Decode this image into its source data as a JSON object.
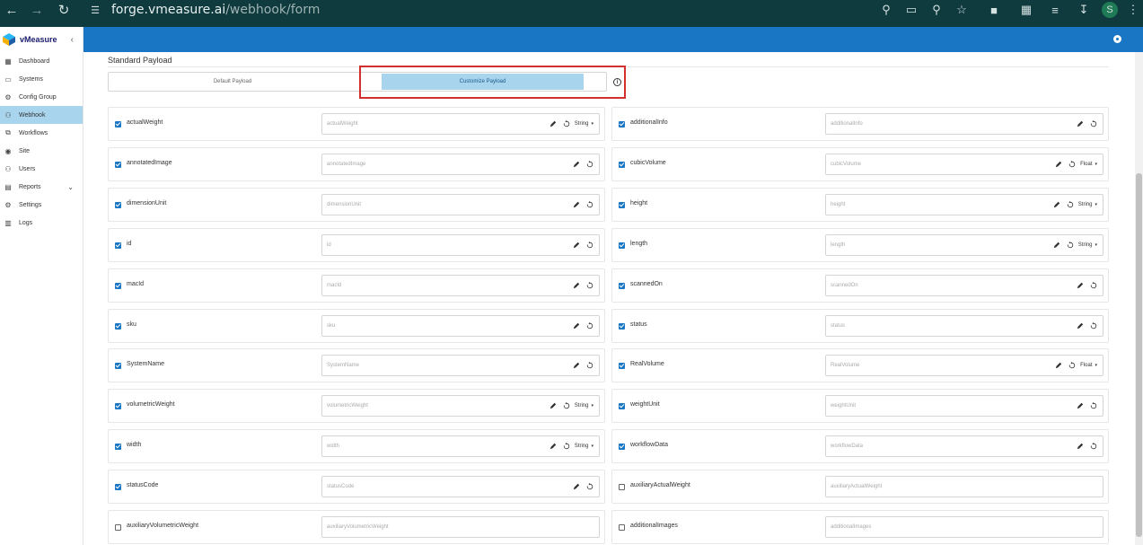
{
  "browser": {
    "url_host": "forge.vmeasure.ai",
    "url_path": "/webhook/form",
    "profile_initial": "S"
  },
  "brand": {
    "name": "vMeasure"
  },
  "sidebar": {
    "items": [
      {
        "label": "Dashboard",
        "icon": "dashboard-icon"
      },
      {
        "label": "Systems",
        "icon": "monitor-icon"
      },
      {
        "label": "Config Group",
        "icon": "config-icon"
      },
      {
        "label": "Webhook",
        "icon": "webhook-icon",
        "active": true
      },
      {
        "label": "Workflows",
        "icon": "workflow-icon"
      },
      {
        "label": "Site",
        "icon": "location-icon"
      },
      {
        "label": "Users",
        "icon": "users-icon"
      },
      {
        "label": "Reports",
        "icon": "reports-icon",
        "has_children": true
      },
      {
        "label": "Settings",
        "icon": "gear-icon"
      },
      {
        "label": "Logs",
        "icon": "logs-icon"
      }
    ]
  },
  "payload": {
    "section_title": "Standard Payload",
    "default_label": "Default Payload",
    "custom_label": "Customize Payload",
    "selected": "Customize Payload"
  },
  "fields": {
    "left": [
      {
        "name": "actualWeight",
        "placeholder": "actualWeight",
        "checked": true,
        "editable": true,
        "type": "String"
      },
      {
        "name": "annotatedImage",
        "placeholder": "annotatedImage",
        "checked": true,
        "editable": true,
        "type": ""
      },
      {
        "name": "dimensionUnit",
        "placeholder": "dimensionUnit",
        "checked": true,
        "editable": true,
        "type": ""
      },
      {
        "name": "id",
        "placeholder": "id",
        "checked": true,
        "editable": true,
        "type": ""
      },
      {
        "name": "macId",
        "placeholder": "macId",
        "checked": true,
        "editable": true,
        "type": ""
      },
      {
        "name": "sku",
        "placeholder": "sku",
        "checked": true,
        "editable": true,
        "type": ""
      },
      {
        "name": "SystemName",
        "placeholder": "SystemName",
        "checked": true,
        "editable": true,
        "type": ""
      },
      {
        "name": "volumetricWeight",
        "placeholder": "volumetricWeight",
        "checked": true,
        "editable": true,
        "type": "String"
      },
      {
        "name": "width",
        "placeholder": "width",
        "checked": true,
        "editable": true,
        "type": "String"
      },
      {
        "name": "statusCode",
        "placeholder": "statusCode",
        "checked": true,
        "editable": true,
        "type": ""
      },
      {
        "name": "auxiliaryVolumetricWeight",
        "placeholder": "auxiliaryVolumetricWeight",
        "checked": false,
        "editable": false,
        "type": ""
      }
    ],
    "right": [
      {
        "name": "additionalInfo",
        "placeholder": "additionalInfo",
        "checked": true,
        "editable": true,
        "type": ""
      },
      {
        "name": "cubicVolume",
        "placeholder": "cubicVolume",
        "checked": true,
        "editable": true,
        "type": "Float"
      },
      {
        "name": "height",
        "placeholder": "height",
        "checked": true,
        "editable": true,
        "type": "String"
      },
      {
        "name": "length",
        "placeholder": "length",
        "checked": true,
        "editable": true,
        "type": "String"
      },
      {
        "name": "scannedOn",
        "placeholder": "scannedOn",
        "checked": true,
        "editable": true,
        "type": ""
      },
      {
        "name": "status",
        "placeholder": "status",
        "checked": true,
        "editable": true,
        "type": ""
      },
      {
        "name": "RealVolume",
        "placeholder": "RealVolume",
        "checked": true,
        "editable": true,
        "type": "Float"
      },
      {
        "name": "weightUnit",
        "placeholder": "weightUnit",
        "checked": true,
        "editable": true,
        "type": ""
      },
      {
        "name": "workflowData",
        "placeholder": "workflowData",
        "checked": true,
        "editable": true,
        "type": ""
      },
      {
        "name": "auxiliaryActualWeight",
        "placeholder": "auxiliaryActualWeight",
        "checked": false,
        "editable": false,
        "type": ""
      },
      {
        "name": "additionalImages",
        "placeholder": "additionalImages",
        "checked": false,
        "editable": false,
        "type": ""
      }
    ]
  },
  "colors": {
    "chrome_bg": "#0f3a3e",
    "appbar": "#1976c5",
    "active_item": "#a8d4ee",
    "highlight": "#d32f2f"
  }
}
